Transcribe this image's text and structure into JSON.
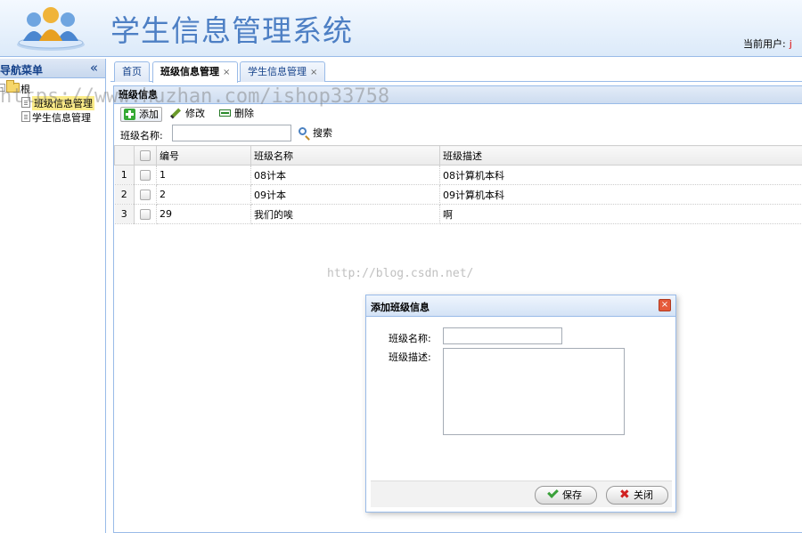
{
  "header": {
    "title": "学生信息管理系统",
    "user_label": "当前用户:",
    "user_name": "j"
  },
  "nav": {
    "title": "导航菜单",
    "collapse": "«",
    "root": "根",
    "items": [
      {
        "label": "班级信息管理",
        "selected": true
      },
      {
        "label": "学生信息管理",
        "selected": false
      }
    ]
  },
  "tabs": [
    {
      "label": "首页",
      "closable": false
    },
    {
      "label": "班级信息管理",
      "closable": true,
      "active": true
    },
    {
      "label": "学生信息管理",
      "closable": true
    }
  ],
  "tab_close": "×",
  "panel": {
    "title": "班级信息",
    "toolbar": {
      "add": "添加",
      "edit": "修改",
      "delete": "删除"
    },
    "search": {
      "label": "班级名称:",
      "value": "",
      "button": "搜索"
    }
  },
  "grid": {
    "columns": [
      "编号",
      "班级名称",
      "班级描述"
    ],
    "rows": [
      {
        "rn": "1",
        "id": "1",
        "name": "08计本",
        "desc": "08计算机本科"
      },
      {
        "rn": "2",
        "id": "2",
        "name": "09计本",
        "desc": "09计算机本科"
      },
      {
        "rn": "3",
        "id": "29",
        "name": "我们的唉",
        "desc": "啊"
      }
    ]
  },
  "watermarks": {
    "top": "https://www.huzhan.com/ishop33758",
    "middle": "http://blog.csdn.net/"
  },
  "dialog": {
    "title": "添加班级信息",
    "close": "×",
    "name_label": "班级名称:",
    "desc_label": "班级描述:",
    "name_value": "",
    "desc_value": "",
    "save": "保存",
    "cancel": "关闭"
  },
  "colors": {
    "accent": "#99bbe8",
    "title_blue": "#4d7fc4",
    "header_text": "#15428b",
    "user_name": "#dd0000"
  },
  "icons": {
    "logo": "users-group-icon",
    "add": "plus-icon",
    "edit": "pencil-icon",
    "delete": "minus-icon",
    "search": "magnifier-icon",
    "save": "check-icon",
    "cancel": "cross-icon"
  }
}
